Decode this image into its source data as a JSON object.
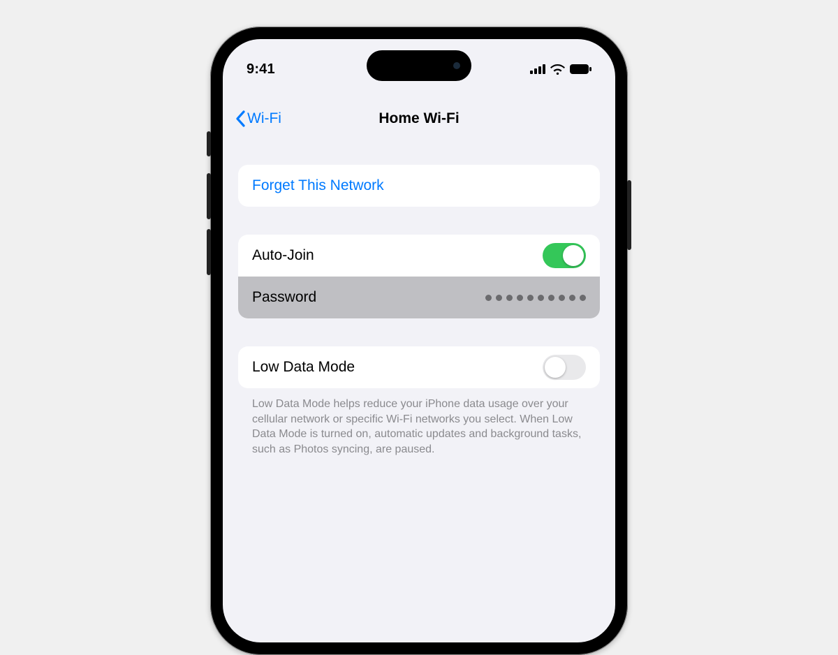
{
  "status": {
    "time": "9:41"
  },
  "nav": {
    "back_label": "Wi-Fi",
    "title": "Home Wi-Fi"
  },
  "forget": {
    "label": "Forget This Network"
  },
  "settings": {
    "auto_join_label": "Auto-Join",
    "password_label": "Password",
    "password_dots": 10
  },
  "low_data": {
    "label": "Low Data Mode",
    "footnote": "Low Data Mode helps reduce your iPhone data usage over your cellular network or specific Wi-Fi networks you select. When Low Data Mode is turned on, automatic updates and background tasks, such as Photos syncing, are paused."
  }
}
